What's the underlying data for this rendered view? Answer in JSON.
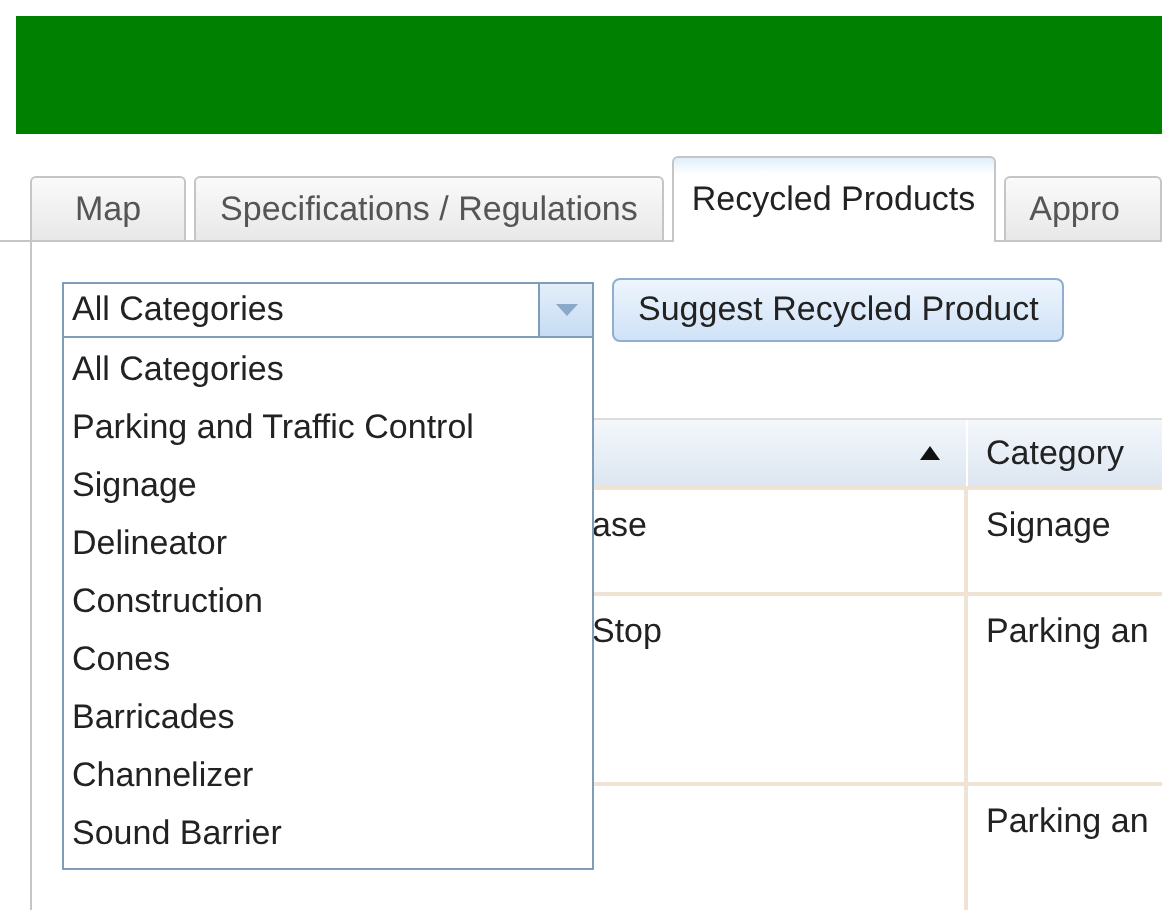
{
  "tabs": [
    {
      "label": "Map",
      "selected": false
    },
    {
      "label": "Specifications / Regulations",
      "selected": false
    },
    {
      "label": "Recycled Products",
      "selected": true
    },
    {
      "label": "Appro",
      "selected": false
    }
  ],
  "category_select": {
    "value": "All Categories",
    "expanded": true,
    "options": [
      {
        "label": "All Categories"
      },
      {
        "label": "Parking and Traffic Control"
      },
      {
        "label": "Signage"
      },
      {
        "label": "Delineator"
      },
      {
        "label": "Construction"
      },
      {
        "label": "Cones"
      },
      {
        "label": "Barricades"
      },
      {
        "label": "Channelizer"
      },
      {
        "label": "Sound Barrier"
      }
    ]
  },
  "suggest_button": "Suggest Recycled Product",
  "table": {
    "columns": [
      {
        "sorted_ascending": true
      },
      {
        "label": "Category",
        "sorted_ascending": false
      }
    ],
    "rows": [
      {
        "column_1": "ase",
        "category": "Signage"
      },
      {
        "column_1": "Stop",
        "category": "Parking an"
      },
      {
        "category": "Parking an"
      }
    ]
  }
}
